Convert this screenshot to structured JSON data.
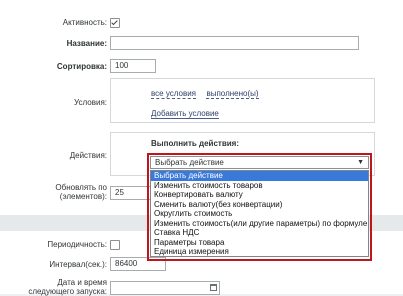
{
  "fields": {
    "active_label": "Активность:",
    "name_label": "Название:",
    "name_value": "",
    "sort_label": "Сортировка:",
    "sort_value": "100",
    "conditions_label": "Условия:",
    "all_conditions_link": "все условия",
    "fulfilled_link": "выполнено(ы)",
    "add_condition_link": "Добавить условие",
    "actions_label": "Действия:",
    "execute_actions_title": "Выполнить действия:",
    "update_label_line1": "Обновлять по",
    "update_label_line2": "(элементов):",
    "update_value": "25",
    "periodicity_label": "Периодичность:",
    "interval_label": "Интервал(сек.):",
    "interval_value": "86400",
    "next_run_line1": "Дата и время",
    "next_run_line2": "следующего запуска:",
    "next_run_value": ""
  },
  "action_select": {
    "selected": "Выбрать действие",
    "arrow": "▼",
    "options": [
      "Выбрать действие",
      "Изменить стоимость товаров",
      "Конвертировать валюту",
      "Сменить валюту(без конвертации)",
      "Округлить стоимость",
      "Изменить стоимость(или другие параметры) по формуле",
      "Ставка НДС",
      "Параметры товара",
      "Единица измерения"
    ]
  },
  "colors": {
    "highlight_border": "#c2151b",
    "selected_option": "#3879d9",
    "link": "#2f3f66"
  }
}
